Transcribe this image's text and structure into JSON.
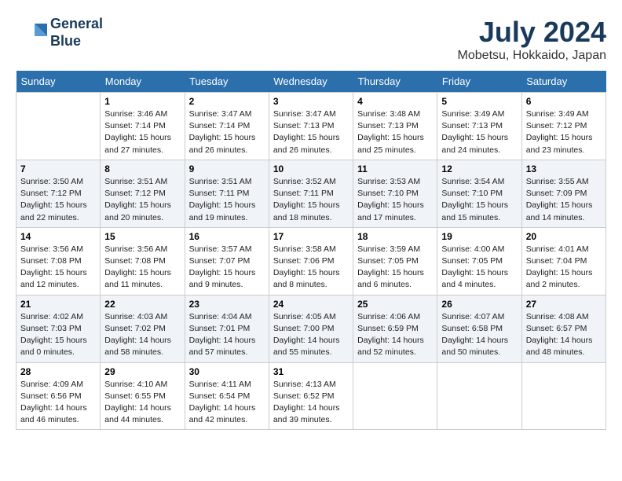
{
  "header": {
    "logo_line1": "General",
    "logo_line2": "Blue",
    "month_year": "July 2024",
    "location": "Mobetsu, Hokkaido, Japan"
  },
  "days_of_week": [
    "Sunday",
    "Monday",
    "Tuesday",
    "Wednesday",
    "Thursday",
    "Friday",
    "Saturday"
  ],
  "weeks": [
    [
      {
        "day": "",
        "sunrise": "",
        "sunset": "",
        "daylight": ""
      },
      {
        "day": "1",
        "sunrise": "3:46 AM",
        "sunset": "7:14 PM",
        "daylight": "15 hours and 27 minutes."
      },
      {
        "day": "2",
        "sunrise": "3:47 AM",
        "sunset": "7:14 PM",
        "daylight": "15 hours and 26 minutes."
      },
      {
        "day": "3",
        "sunrise": "3:47 AM",
        "sunset": "7:13 PM",
        "daylight": "15 hours and 26 minutes."
      },
      {
        "day": "4",
        "sunrise": "3:48 AM",
        "sunset": "7:13 PM",
        "daylight": "15 hours and 25 minutes."
      },
      {
        "day": "5",
        "sunrise": "3:49 AM",
        "sunset": "7:13 PM",
        "daylight": "15 hours and 24 minutes."
      },
      {
        "day": "6",
        "sunrise": "3:49 AM",
        "sunset": "7:12 PM",
        "daylight": "15 hours and 23 minutes."
      }
    ],
    [
      {
        "day": "7",
        "sunrise": "3:50 AM",
        "sunset": "7:12 PM",
        "daylight": "15 hours and 22 minutes."
      },
      {
        "day": "8",
        "sunrise": "3:51 AM",
        "sunset": "7:12 PM",
        "daylight": "15 hours and 20 minutes."
      },
      {
        "day": "9",
        "sunrise": "3:51 AM",
        "sunset": "7:11 PM",
        "daylight": "15 hours and 19 minutes."
      },
      {
        "day": "10",
        "sunrise": "3:52 AM",
        "sunset": "7:11 PM",
        "daylight": "15 hours and 18 minutes."
      },
      {
        "day": "11",
        "sunrise": "3:53 AM",
        "sunset": "7:10 PM",
        "daylight": "15 hours and 17 minutes."
      },
      {
        "day": "12",
        "sunrise": "3:54 AM",
        "sunset": "7:10 PM",
        "daylight": "15 hours and 15 minutes."
      },
      {
        "day": "13",
        "sunrise": "3:55 AM",
        "sunset": "7:09 PM",
        "daylight": "15 hours and 14 minutes."
      }
    ],
    [
      {
        "day": "14",
        "sunrise": "3:56 AM",
        "sunset": "7:08 PM",
        "daylight": "15 hours and 12 minutes."
      },
      {
        "day": "15",
        "sunrise": "3:56 AM",
        "sunset": "7:08 PM",
        "daylight": "15 hours and 11 minutes."
      },
      {
        "day": "16",
        "sunrise": "3:57 AM",
        "sunset": "7:07 PM",
        "daylight": "15 hours and 9 minutes."
      },
      {
        "day": "17",
        "sunrise": "3:58 AM",
        "sunset": "7:06 PM",
        "daylight": "15 hours and 8 minutes."
      },
      {
        "day": "18",
        "sunrise": "3:59 AM",
        "sunset": "7:05 PM",
        "daylight": "15 hours and 6 minutes."
      },
      {
        "day": "19",
        "sunrise": "4:00 AM",
        "sunset": "7:05 PM",
        "daylight": "15 hours and 4 minutes."
      },
      {
        "day": "20",
        "sunrise": "4:01 AM",
        "sunset": "7:04 PM",
        "daylight": "15 hours and 2 minutes."
      }
    ],
    [
      {
        "day": "21",
        "sunrise": "4:02 AM",
        "sunset": "7:03 PM",
        "daylight": "15 hours and 0 minutes."
      },
      {
        "day": "22",
        "sunrise": "4:03 AM",
        "sunset": "7:02 PM",
        "daylight": "14 hours and 58 minutes."
      },
      {
        "day": "23",
        "sunrise": "4:04 AM",
        "sunset": "7:01 PM",
        "daylight": "14 hours and 57 minutes."
      },
      {
        "day": "24",
        "sunrise": "4:05 AM",
        "sunset": "7:00 PM",
        "daylight": "14 hours and 55 minutes."
      },
      {
        "day": "25",
        "sunrise": "4:06 AM",
        "sunset": "6:59 PM",
        "daylight": "14 hours and 52 minutes."
      },
      {
        "day": "26",
        "sunrise": "4:07 AM",
        "sunset": "6:58 PM",
        "daylight": "14 hours and 50 minutes."
      },
      {
        "day": "27",
        "sunrise": "4:08 AM",
        "sunset": "6:57 PM",
        "daylight": "14 hours and 48 minutes."
      }
    ],
    [
      {
        "day": "28",
        "sunrise": "4:09 AM",
        "sunset": "6:56 PM",
        "daylight": "14 hours and 46 minutes."
      },
      {
        "day": "29",
        "sunrise": "4:10 AM",
        "sunset": "6:55 PM",
        "daylight": "14 hours and 44 minutes."
      },
      {
        "day": "30",
        "sunrise": "4:11 AM",
        "sunset": "6:54 PM",
        "daylight": "14 hours and 42 minutes."
      },
      {
        "day": "31",
        "sunrise": "4:13 AM",
        "sunset": "6:52 PM",
        "daylight": "14 hours and 39 minutes."
      },
      {
        "day": "",
        "sunrise": "",
        "sunset": "",
        "daylight": ""
      },
      {
        "day": "",
        "sunrise": "",
        "sunset": "",
        "daylight": ""
      },
      {
        "day": "",
        "sunrise": "",
        "sunset": "",
        "daylight": ""
      }
    ]
  ]
}
